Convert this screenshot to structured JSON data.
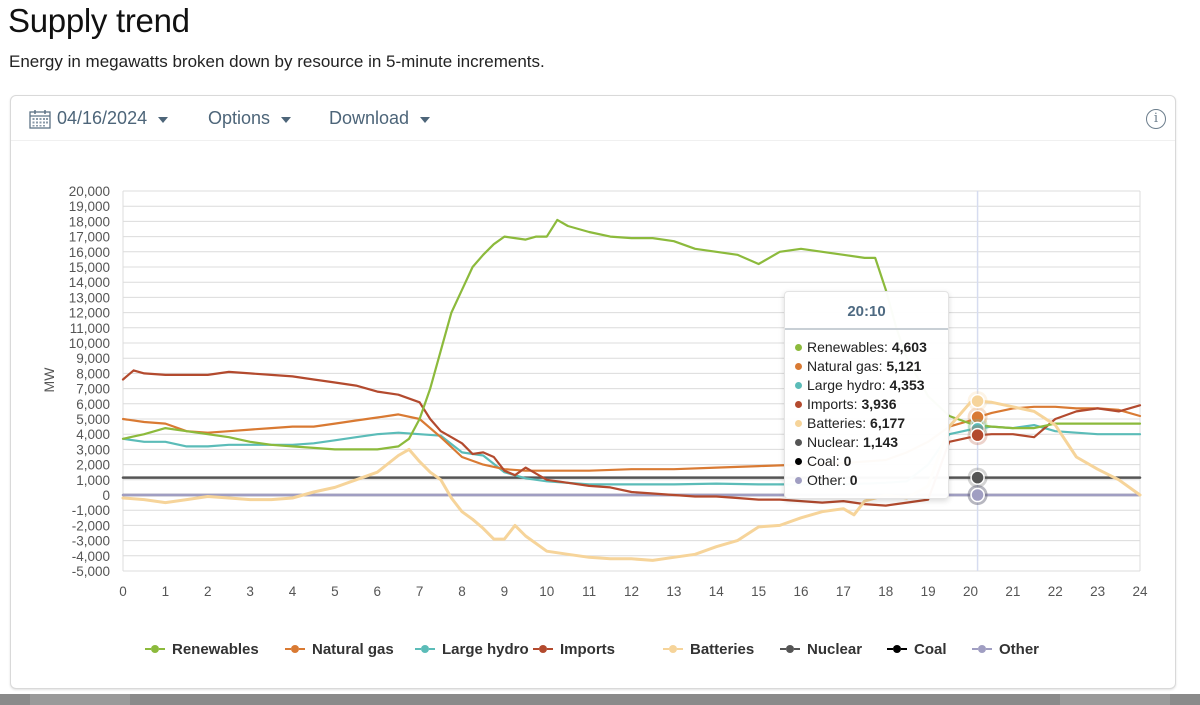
{
  "header": {
    "title": "Supply trend",
    "subtitle": "Energy in megawatts broken down by resource in 5-minute increments."
  },
  "toolbar": {
    "date_value": "04/16/2024",
    "date_icon": "calendar-icon",
    "options_label": "Options",
    "download_label": "Download",
    "info_icon": "info-icon"
  },
  "tooltip": {
    "time": "20:10",
    "rows": [
      {
        "label": "Renewables: ",
        "value": "4,603",
        "color": "#8cba3c"
      },
      {
        "label": "Natural gas: ",
        "value": "5,121",
        "color": "#d97a33"
      },
      {
        "label": "Large hydro: ",
        "value": "4,353",
        "color": "#5bbcb8"
      },
      {
        "label": "Imports: ",
        "value": "3,936",
        "color": "#b34a2e"
      },
      {
        "label": "Batteries: ",
        "value": "6,177",
        "color": "#f6d49a"
      },
      {
        "label": "Nuclear: ",
        "value": "1,143",
        "color": "#555555"
      },
      {
        "label": "Coal: ",
        "value": "0",
        "color": "#000000"
      },
      {
        "label": "Other: ",
        "value": "0",
        "color": "#a09ec2"
      }
    ]
  },
  "chart_data": {
    "type": "line",
    "title": "Supply trend",
    "subtitle": "Energy in megawatts broken down by resource in 5-minute increments.",
    "xlabel": "",
    "ylabel": "MW",
    "xlim": [
      0,
      24
    ],
    "ylim": [
      -5000,
      20000
    ],
    "x_ticks": [
      "0",
      "1",
      "2",
      "3",
      "4",
      "5",
      "6",
      "7",
      "8",
      "9",
      "10",
      "11",
      "12",
      "13",
      "14",
      "15",
      "16",
      "17",
      "18",
      "19",
      "20",
      "21",
      "22",
      "23",
      "24"
    ],
    "y_ticks": [
      "20,000",
      "19,000",
      "18,000",
      "17,000",
      "16,000",
      "15,000",
      "14,000",
      "13,000",
      "12,000",
      "11,000",
      "10,000",
      "9,000",
      "8,000",
      "7,000",
      "6,000",
      "5,000",
      "4,000",
      "3,000",
      "2,000",
      "1,000",
      "0",
      "-1,000",
      "-2,000",
      "-3,000",
      "-4,000",
      "-5,000"
    ],
    "y_tick_values": [
      20000,
      19000,
      18000,
      17000,
      16000,
      15000,
      14000,
      13000,
      12000,
      11000,
      10000,
      9000,
      8000,
      7000,
      6000,
      5000,
      4000,
      3000,
      2000,
      1000,
      0,
      -1000,
      -2000,
      -3000,
      -4000,
      -5000
    ],
    "grid": true,
    "legend_position": "bottom",
    "hover_x": 20.167,
    "series": [
      {
        "name": "Renewables",
        "color": "#8cba3c",
        "x": [
          0,
          0.5,
          1,
          1.5,
          2,
          2.5,
          3,
          3.5,
          4,
          4.5,
          5,
          5.5,
          6,
          6.5,
          6.75,
          7,
          7.25,
          7.5,
          7.75,
          8,
          8.25,
          8.5,
          8.75,
          9,
          9.25,
          9.5,
          9.75,
          10,
          10.25,
          10.5,
          11,
          11.5,
          12,
          12.5,
          13,
          13.5,
          14,
          14.5,
          15,
          15.25,
          15.5,
          16,
          16.5,
          17,
          17.5,
          17.75,
          18,
          18.25,
          18.5,
          19,
          19.5,
          20,
          20.167,
          20.5,
          21,
          21.5,
          22,
          22.5,
          23,
          24
        ],
        "values": [
          3700,
          4000,
          4400,
          4200,
          4000,
          3800,
          3500,
          3300,
          3200,
          3100,
          3000,
          3000,
          3000,
          3200,
          3700,
          5000,
          7000,
          9500,
          12000,
          13500,
          15000,
          15800,
          16500,
          17000,
          16900,
          16800,
          17000,
          17000,
          18100,
          17700,
          17300,
          17000,
          16900,
          16900,
          16700,
          16200,
          16000,
          15800,
          15200,
          15600,
          16000,
          16200,
          16000,
          15800,
          15600,
          15600,
          13500,
          11000,
          9000,
          6500,
          5200,
          4700,
          4603,
          4500,
          4400,
          4400,
          4700,
          4700,
          4700,
          4700
        ]
      },
      {
        "name": "Natural gas",
        "color": "#d97a33",
        "x": [
          0,
          0.5,
          1,
          1.5,
          2,
          2.5,
          3,
          3.5,
          4,
          4.5,
          5,
          5.5,
          6,
          6.5,
          7,
          7.5,
          8,
          8.5,
          9,
          9.5,
          10,
          11,
          12,
          13,
          14,
          15,
          16,
          17,
          18,
          18.5,
          19,
          19.5,
          20,
          20.167,
          20.5,
          21,
          21.5,
          22,
          22.5,
          23,
          23.5,
          24
        ],
        "values": [
          5000,
          4800,
          4700,
          4200,
          4100,
          4200,
          4300,
          4400,
          4500,
          4500,
          4700,
          4900,
          5100,
          5300,
          5000,
          3800,
          2500,
          2000,
          1700,
          1600,
          1600,
          1600,
          1700,
          1700,
          1800,
          1900,
          2000,
          2100,
          2300,
          2800,
          3500,
          4500,
          4900,
          5121,
          5400,
          5700,
          5800,
          5800,
          5700,
          5700,
          5600,
          5200
        ]
      },
      {
        "name": "Large hydro",
        "color": "#5bbcb8",
        "x": [
          0,
          0.5,
          1,
          1.5,
          2,
          2.5,
          3,
          3.5,
          4,
          4.5,
          5,
          5.5,
          6,
          6.5,
          7,
          7.5,
          8,
          8.5,
          9,
          9.5,
          10,
          11,
          12,
          13,
          14,
          15,
          16,
          17,
          18,
          18.5,
          19,
          19.5,
          20,
          20.167,
          20.5,
          21,
          21.5,
          22,
          22.5,
          23,
          24
        ],
        "values": [
          3700,
          3500,
          3500,
          3200,
          3200,
          3300,
          3300,
          3300,
          3300,
          3400,
          3600,
          3800,
          4000,
          4100,
          4000,
          3900,
          2800,
          2600,
          1500,
          1100,
          900,
          700,
          700,
          700,
          750,
          700,
          700,
          700,
          800,
          900,
          2000,
          4000,
          4300,
          4353,
          4500,
          4400,
          4600,
          4200,
          4100,
          4000,
          4000
        ]
      },
      {
        "name": "Imports",
        "color": "#b34a2e",
        "x": [
          0,
          0.25,
          0.5,
          1,
          1.5,
          2,
          2.5,
          3,
          3.5,
          4,
          4.5,
          5,
          5.5,
          6,
          6.5,
          7,
          7.25,
          7.5,
          7.75,
          8,
          8.25,
          8.5,
          8.75,
          9,
          9.25,
          9.5,
          10,
          10.5,
          11,
          11.5,
          12,
          12.5,
          13,
          13.5,
          14,
          14.5,
          15,
          15.5,
          16,
          16.5,
          17,
          17.5,
          18,
          18.5,
          19,
          19.5,
          20,
          20.167,
          20.5,
          21,
          21.5,
          22,
          22.5,
          23,
          23.5,
          24
        ],
        "values": [
          7600,
          8200,
          8000,
          7900,
          7900,
          7900,
          8100,
          8000,
          7900,
          7800,
          7600,
          7400,
          7200,
          6800,
          6600,
          6100,
          5000,
          4200,
          3800,
          3400,
          2700,
          2800,
          2500,
          1600,
          1300,
          1800,
          1000,
          800,
          600,
          500,
          200,
          100,
          0,
          -100,
          -100,
          -200,
          -300,
          -300,
          -400,
          -500,
          -400,
          -600,
          -700,
          -500,
          -300,
          3500,
          3800,
          3936,
          4000,
          4000,
          3800,
          5000,
          5500,
          5700,
          5500,
          5900
        ]
      },
      {
        "name": "Batteries",
        "color": "#f6d49a",
        "x": [
          0,
          0.5,
          1,
          1.5,
          2,
          2.5,
          3,
          3.5,
          4,
          4.5,
          5,
          5.5,
          6,
          6.5,
          6.75,
          7,
          7.25,
          7.5,
          7.75,
          8,
          8.25,
          8.5,
          8.75,
          9,
          9.25,
          9.5,
          10,
          10.5,
          11,
          11.5,
          12,
          12.5,
          13,
          13.5,
          14,
          14.5,
          15,
          15.5,
          16,
          16.5,
          17,
          17.25,
          17.5,
          18,
          18.5,
          19,
          19.5,
          20,
          20.167,
          20.5,
          21,
          21.5,
          22,
          22.5,
          23,
          23.5,
          24
        ],
        "values": [
          -200,
          -300,
          -500,
          -300,
          -100,
          -200,
          -300,
          -300,
          -200,
          200,
          500,
          1000,
          1500,
          2600,
          3000,
          2200,
          1500,
          1000,
          -200,
          -1100,
          -1600,
          -2200,
          -2900,
          -2900,
          -2000,
          -2700,
          -3700,
          -3900,
          -4100,
          -4200,
          -4200,
          -4300,
          -4100,
          -3900,
          -3400,
          -3000,
          -2100,
          -2000,
          -1500,
          -1100,
          -900,
          -1300,
          -400,
          0,
          -200,
          600,
          4500,
          6100,
          6177,
          6100,
          5800,
          5500,
          4600,
          2500,
          1700,
          1000,
          0
        ]
      },
      {
        "name": "Nuclear",
        "color": "#555555",
        "x": [
          0,
          24
        ],
        "values": [
          1143,
          1143
        ]
      },
      {
        "name": "Coal",
        "color": "#000000",
        "x": [
          0,
          24
        ],
        "values": [
          0,
          0
        ]
      },
      {
        "name": "Other",
        "color": "#a09ec2",
        "x": [
          0,
          24
        ],
        "values": [
          0,
          0
        ]
      }
    ]
  }
}
